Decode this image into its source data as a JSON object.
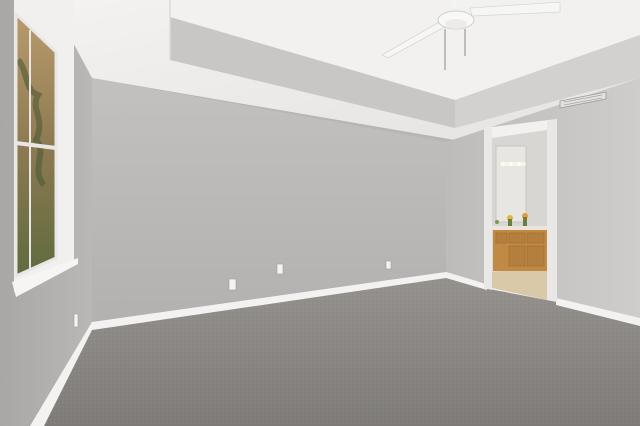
{
  "scene": {
    "subject": "empty-bedroom-interior",
    "colors": {
      "ceiling": "#efeeec",
      "tray_soffit": "#c9c7c5",
      "back_wall": "#bdbbb9",
      "left_wall": "#b6b4b2",
      "right_wall": "#c4c2c0",
      "carpet": "#8b8886",
      "baseboard": "#f3f2f0",
      "window_frame": "#f1f0ee",
      "bathroom_wall": "#d8d6d2",
      "vanity_wood": "#c08a45",
      "bathroom_floor": "#d9c9a8"
    },
    "elements": {
      "window": "window-icon",
      "ceiling_fan": "ceiling-fan-icon",
      "doorway": "doorway-icon",
      "vanity": "vanity-icon",
      "air_vent": "air-vent-icon",
      "outlets": "outlet-icon"
    }
  }
}
